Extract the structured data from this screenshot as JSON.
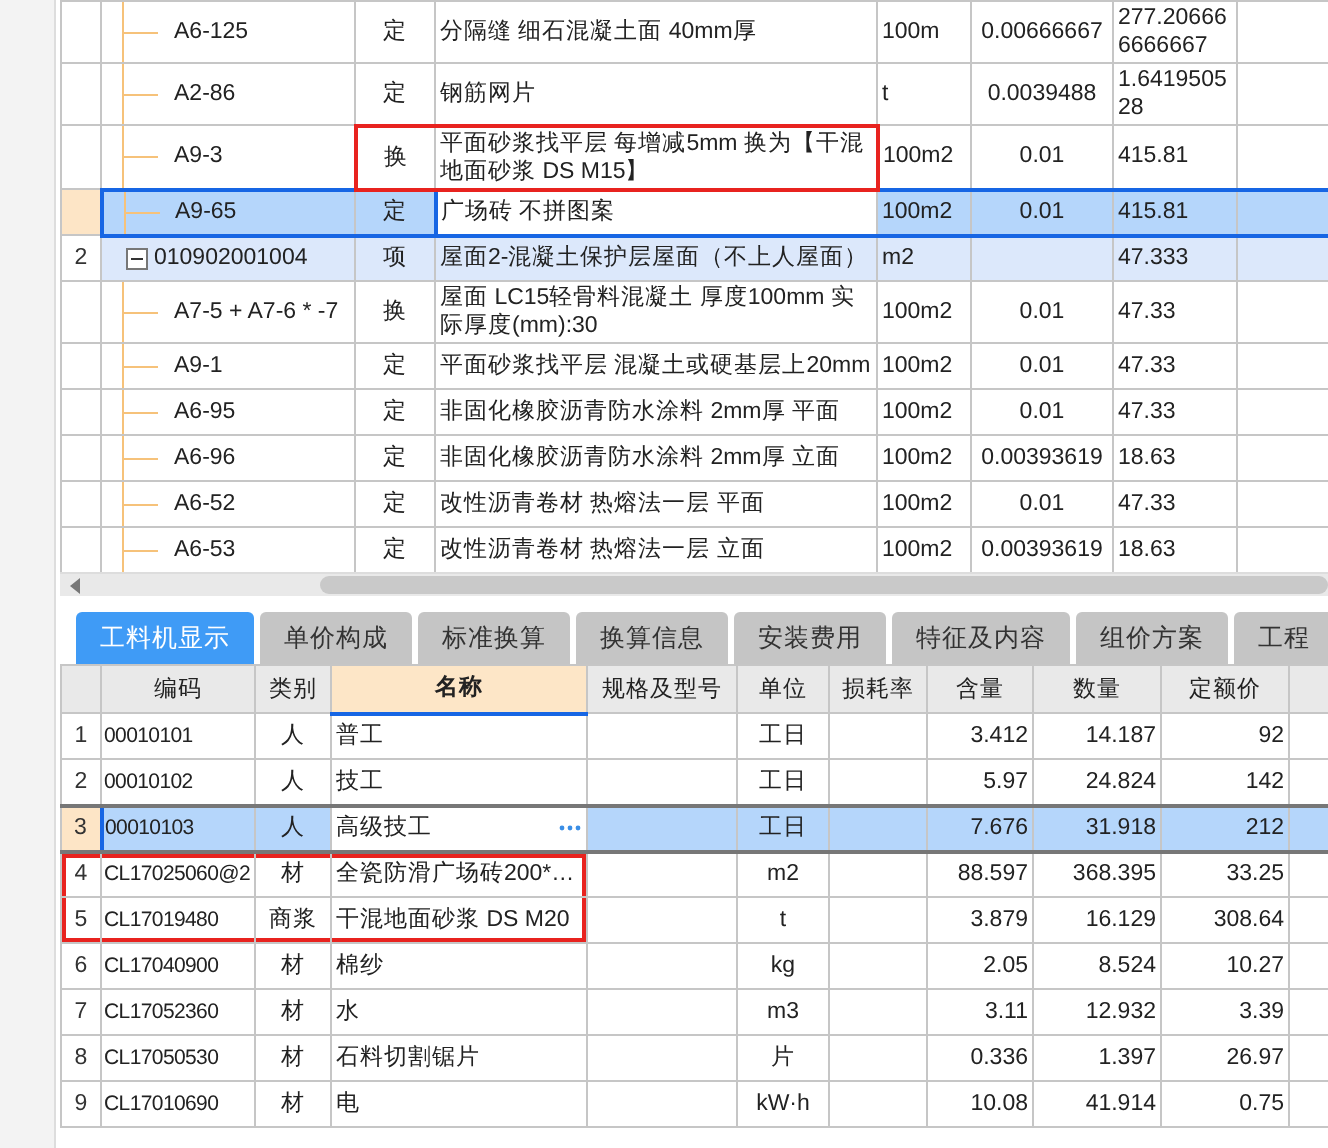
{
  "upper_grid": {
    "previous_item_children": [
      {
        "code": "A6-125",
        "type": "定",
        "name": "分隔缝 细石混凝土面 40mm厚",
        "unit": "100m",
        "content": "0.00666667",
        "total": "277.206666666667",
        "selected": false,
        "highlighted": false
      },
      {
        "code": "A2-86",
        "type": "定",
        "name": "钢筋网片",
        "unit": "t",
        "content": "0.0039488",
        "total": "1.641950528",
        "selected": false,
        "highlighted": false
      },
      {
        "code": "A9-3",
        "type": "换",
        "name": "平面砂浆找平层 每增减5mm  换为【干混地面砂浆 DS M15】",
        "unit": "100m2",
        "content": "0.01",
        "total": "415.81",
        "selected": false,
        "highlighted": true
      },
      {
        "code": "A9-65",
        "type": "定",
        "name": "广场砖 不拼图案",
        "unit": "100m2",
        "content": "0.01",
        "total": "415.81",
        "selected": true,
        "highlighted": false
      }
    ],
    "items": [
      {
        "number": "2",
        "code": "010902001004",
        "type": "项",
        "name": "屋面2-混凝土保护层屋面（不上人屋面）",
        "unit": "m2",
        "total": "47.333",
        "expanded": true,
        "selected": false,
        "children": [
          {
            "code": "A7-5 + A7-6 * -7",
            "type": "换",
            "name": "屋面 LC15轻骨料混凝土 厚度100mm  实际厚度(mm):30",
            "unit": "100m2",
            "content": "0.01",
            "total": "47.33",
            "selected": false,
            "highlighted": false
          },
          {
            "code": "A9-1",
            "type": "定",
            "name": "平面砂浆找平层 混凝土或硬基层上20mm",
            "unit": "100m2",
            "content": "0.01",
            "total": "47.33",
            "selected": false,
            "highlighted": false
          },
          {
            "code": "A6-95",
            "type": "定",
            "name": "非固化橡胶沥青防水涂料 2mm厚 平面",
            "unit": "100m2",
            "content": "0.01",
            "total": "47.33",
            "selected": false,
            "highlighted": false
          },
          {
            "code": "A6-96",
            "type": "定",
            "name": "非固化橡胶沥青防水涂料 2mm厚 立面",
            "unit": "100m2",
            "content": "0.00393619",
            "total": "18.63",
            "selected": false,
            "highlighted": false
          },
          {
            "code": "A6-52",
            "type": "定",
            "name": "改性沥青卷材 热熔法一层 平面",
            "unit": "100m2",
            "content": "0.01",
            "total": "47.33",
            "selected": false,
            "highlighted": false
          },
          {
            "code": "A6-53",
            "type": "定",
            "name": "改性沥青卷材 热熔法一层 立面",
            "unit": "100m2",
            "content": "0.00393619",
            "total": "18.63",
            "selected": false,
            "highlighted": false
          }
        ]
      }
    ]
  },
  "tabs": [
    {
      "label": "工料机显示",
      "selected": true
    },
    {
      "label": "单价构成",
      "selected": false
    },
    {
      "label": "标准换算",
      "selected": false
    },
    {
      "label": "换算信息",
      "selected": false
    },
    {
      "label": "安装费用",
      "selected": false
    },
    {
      "label": "特征及内容",
      "selected": false
    },
    {
      "label": "组价方案",
      "selected": false
    },
    {
      "label": "工程",
      "selected": false
    }
  ],
  "lower_grid": {
    "columns": [
      "编码",
      "类别",
      "名称",
      "规格及型号",
      "单位",
      "损耗率",
      "含量",
      "数量",
      "定额价"
    ],
    "rows": [
      {
        "number": "1",
        "code": "00010101",
        "type": "人",
        "name": "普工",
        "unit": "工日",
        "content": "3.412",
        "quantity": "14.187",
        "price": "92",
        "selected": false,
        "highlighted": false
      },
      {
        "number": "2",
        "code": "00010102",
        "type": "人",
        "name": "技工",
        "unit": "工日",
        "content": "5.97",
        "quantity": "24.824",
        "price": "142",
        "selected": false,
        "highlighted": false
      },
      {
        "number": "3",
        "code": "00010103",
        "type": "人",
        "name": "高级技工",
        "unit": "工日",
        "content": "7.676",
        "quantity": "31.918",
        "price": "212",
        "selected": true,
        "highlighted": false
      },
      {
        "number": "4",
        "code": "CL17025060@2",
        "type": "材",
        "name": "全瓷防滑广场砖200*…",
        "unit": "m2",
        "content": "88.597",
        "quantity": "368.395",
        "price": "33.25",
        "selected": false,
        "highlighted": true
      },
      {
        "number": "5",
        "code": "CL17019480",
        "type": "商浆",
        "name": "干混地面砂浆 DS M20",
        "unit": "t",
        "content": "3.879",
        "quantity": "16.129",
        "price": "308.64",
        "selected": false,
        "highlighted": true
      },
      {
        "number": "6",
        "code": "CL17040900",
        "type": "材",
        "name": "棉纱",
        "unit": "kg",
        "content": "2.05",
        "quantity": "8.524",
        "price": "10.27",
        "selected": false,
        "highlighted": false
      },
      {
        "number": "7",
        "code": "CL17052360",
        "type": "材",
        "name": "水",
        "unit": "m3",
        "content": "3.11",
        "quantity": "12.932",
        "price": "3.39",
        "selected": false,
        "highlighted": false
      },
      {
        "number": "8",
        "code": "CL17050530",
        "type": "材",
        "name": "石料切割锯片",
        "unit": "片",
        "content": "0.336",
        "quantity": "1.397",
        "price": "26.97",
        "selected": false,
        "highlighted": false
      },
      {
        "number": "9",
        "code": "CL17010690",
        "type": "材",
        "name": "电",
        "unit": "kW·h",
        "content": "10.08",
        "quantity": "41.914",
        "price": "0.75",
        "selected": false,
        "highlighted": false
      }
    ]
  }
}
